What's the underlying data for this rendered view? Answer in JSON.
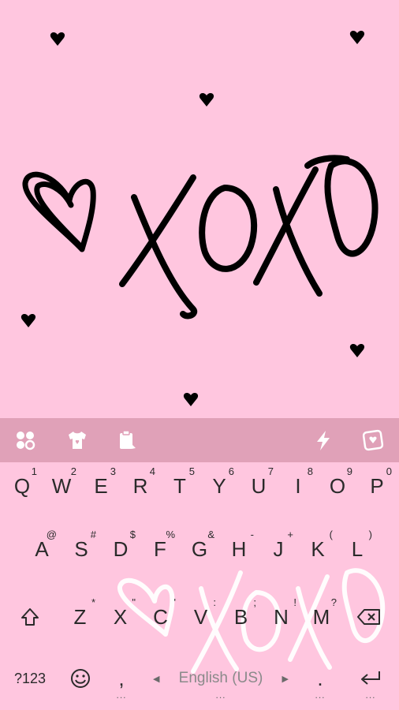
{
  "hero": {
    "logo_text": "XOXO",
    "background": "#ffc6df"
  },
  "toolbar": {
    "background": "#e0a1b8",
    "left_icons": [
      "apps-icon",
      "theme-shirt-icon",
      "clipboard-icon"
    ],
    "right_icons": [
      "lightning-icon",
      "sticker-icon"
    ]
  },
  "keyboard": {
    "row1": [
      {
        "key": "Q",
        "hint": "1"
      },
      {
        "key": "W",
        "hint": "2"
      },
      {
        "key": "E",
        "hint": "3"
      },
      {
        "key": "R",
        "hint": "4"
      },
      {
        "key": "T",
        "hint": "5"
      },
      {
        "key": "Y",
        "hint": "6"
      },
      {
        "key": "U",
        "hint": "7"
      },
      {
        "key": "I",
        "hint": "8"
      },
      {
        "key": "O",
        "hint": "9"
      },
      {
        "key": "P",
        "hint": "0"
      }
    ],
    "row2": [
      {
        "key": "A",
        "hint": "@"
      },
      {
        "key": "S",
        "hint": "#"
      },
      {
        "key": "D",
        "hint": "$"
      },
      {
        "key": "F",
        "hint": "%"
      },
      {
        "key": "G",
        "hint": "&"
      },
      {
        "key": "H",
        "hint": "-"
      },
      {
        "key": "J",
        "hint": "+"
      },
      {
        "key": "K",
        "hint": "("
      },
      {
        "key": "L",
        "hint": ")"
      }
    ],
    "row3": [
      {
        "key": "Z",
        "hint": "*"
      },
      {
        "key": "X",
        "hint": "\""
      },
      {
        "key": "C",
        "hint": "'"
      },
      {
        "key": "V",
        "hint": ":"
      },
      {
        "key": "B",
        "hint": ";"
      },
      {
        "key": "N",
        "hint": "!"
      },
      {
        "key": "M",
        "hint": "?"
      }
    ],
    "symbols_label": "?123",
    "comma_label": ",",
    "space_label": "English (US)",
    "period_label": ".",
    "text_color": "#2a2a2a"
  }
}
